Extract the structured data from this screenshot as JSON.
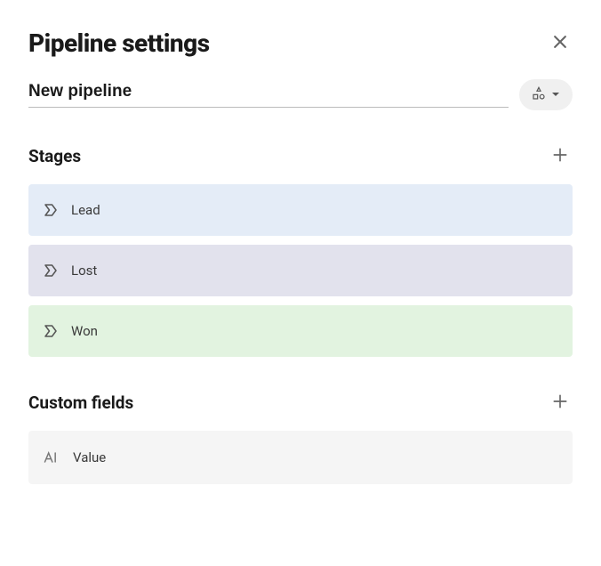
{
  "header": {
    "title": "Pipeline settings"
  },
  "pipeline": {
    "name": "New pipeline"
  },
  "sections": {
    "stages_title": "Stages",
    "custom_fields_title": "Custom fields"
  },
  "stages": [
    {
      "label": "Lead",
      "color": "blue"
    },
    {
      "label": "Lost",
      "color": "purple"
    },
    {
      "label": "Won",
      "color": "green"
    }
  ],
  "custom_fields": [
    {
      "label": "Value",
      "type": "text"
    }
  ]
}
